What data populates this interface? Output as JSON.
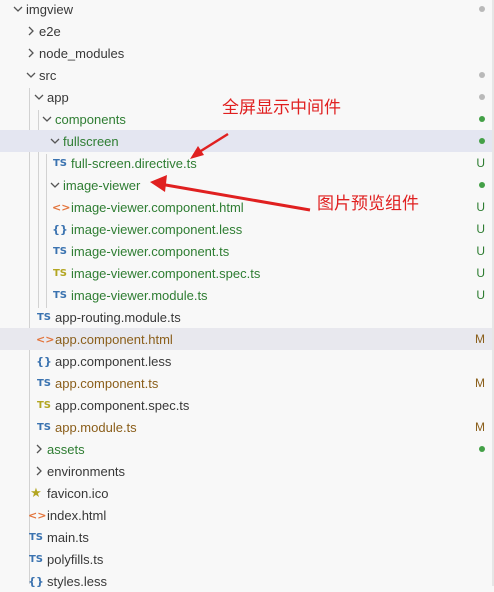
{
  "tree": {
    "root": "imgview",
    "e2e": "e2e",
    "node_modules": "node_modules",
    "src": "src",
    "app": "app",
    "components": "components",
    "fullscreen": "fullscreen",
    "full_screen_directive": "full-screen.directive.ts",
    "image_viewer": "image-viewer",
    "iv_html": "image-viewer.component.html",
    "iv_less": "image-viewer.component.less",
    "iv_ts": "image-viewer.component.ts",
    "iv_spec": "image-viewer.component.spec.ts",
    "iv_module": "image-viewer.module.ts",
    "app_routing": "app-routing.module.ts",
    "app_html": "app.component.html",
    "app_less": "app.component.less",
    "app_ts": "app.component.ts",
    "app_spec": "app.component.spec.ts",
    "app_module": "app.module.ts",
    "assets": "assets",
    "environments": "environments",
    "favicon": "favicon.ico",
    "index_html": "index.html",
    "main_ts": "main.ts",
    "polyfills": "polyfills.ts",
    "styles": "styles.less"
  },
  "icons": {
    "ts": "TS",
    "html": "<>",
    "less": "{}",
    "star": "★"
  },
  "status": {
    "untracked": "U",
    "modified": "M"
  },
  "annotations": {
    "fullscreen_note": "全屏显示中间件",
    "viewer_note": "图片预览组件"
  },
  "colors": {
    "annotation": "#e02020",
    "untracked": "#2e7d32",
    "modified": "#8a5e1a",
    "selection": "#e4e6f1"
  }
}
